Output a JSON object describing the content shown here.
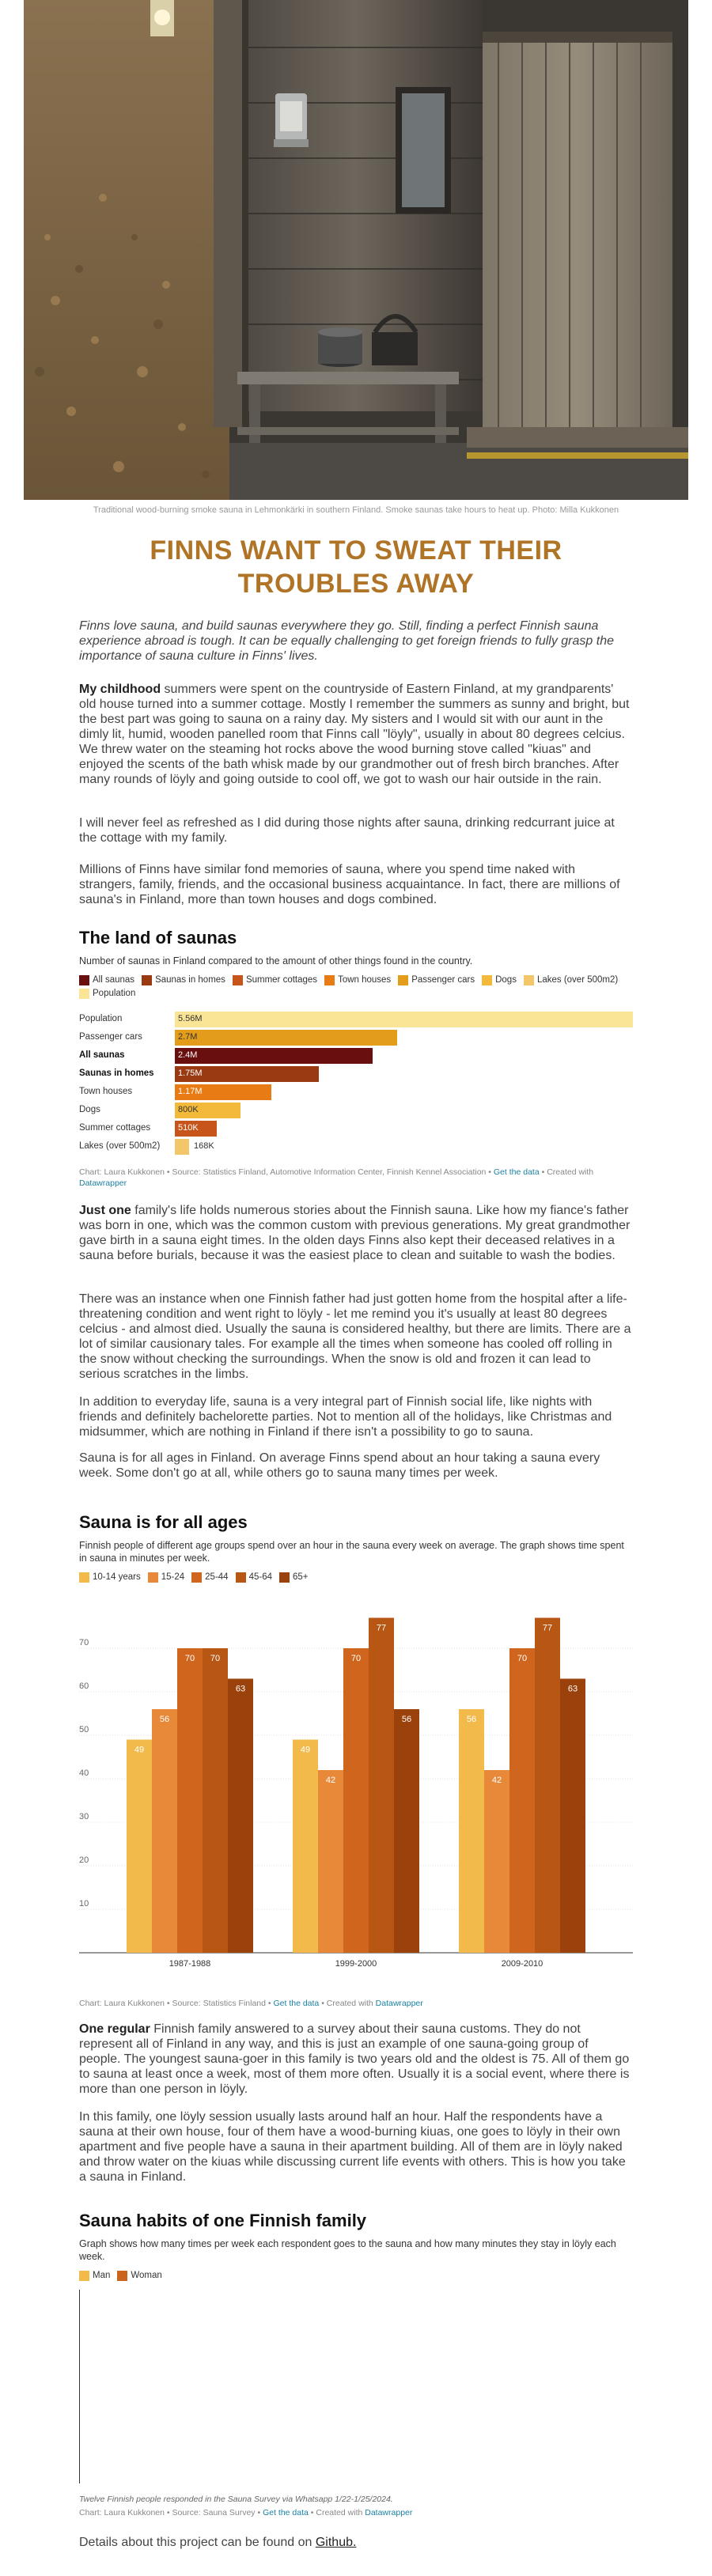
{
  "hero": {
    "caption": "Traditional wood-burning smoke sauna in Lehmonkärki in southern Finland. Smoke saunas take hours to heat up. Photo: Milla Kukkonen"
  },
  "title": "FINNS WANT TO SWEAT THEIR TROUBLES AWAY",
  "intro": "Finns love sauna, and build saunas everywhere they go. Still, finding a perfect Finnish sauna experience abroad is tough. It can be equally challenging to get foreign friends to fully grasp the importance of sauna culture in Finns' lives.",
  "p1_lead": "My childhood",
  "p1": " summers were spent on the countryside of Eastern Finland, at my grandparents' old house turned into a summer cottage. Mostly I remember the summers as sunny and bright, but the best part was going to sauna on a rainy day. My sisters and I would sit with our aunt in the dimly lit, humid, wooden panelled room that Finns call \"löyly\", usually in about 80 degrees celcius. We threw water on the steaming hot rocks above the wood burning stove called \"kiuas\" and enjoyed the scents of the bath whisk made by our grandmother out of fresh birch branches. After many rounds of löyly and going outside to cool off, we got to wash our hair outside in the rain.",
  "p2": "I will never feel as refreshed as I did during those nights after sauna, drinking redcurrant juice at the cottage with my family.",
  "p3": "Millions of Finns have similar fond memories of sauna, where you spend time naked with strangers, family, friends, and the occasional business acquaintance. In fact, there are millions of sauna's in Finland, more than town houses and dogs combined.",
  "chart1": {
    "title": "The land of saunas",
    "subtitle": "Number of saunas in Finland compared to the amount of other things found in the country.",
    "footer": "Chart: Laura Kukkonen • Source: Statistics Finland, Automotive Information Center, Finnish Kennel Association • ",
    "get_data": "Get the data",
    "created": " • Created with ",
    "datawrapper": "Datawrapper"
  },
  "p4_lead": "Just one",
  "p4": " family's life holds numerous stories about the Finnish sauna. Like how my fiance's father was born in one, which was the common custom with previous generations. My great grandmother gave birth in a sauna eight times. In the olden days Finns also kept their deceased relatives in a sauna before burials, because it was the easiest place to clean and suitable to wash the bodies.",
  "p5": "There was an instance when one Finnish father had just gotten home from the hospital after a life-threatening condition and went right to löyly - let me remind you it's usually at least 80 degrees celcius - and almost died. Usually the sauna is considered healthy, but there are limits. There are a lot of similar causionary tales. For example all the times when someone has cooled off rolling in the snow without checking the surroundings. When the snow is old and frozen it can lead to serious scratches in the limbs.",
  "p6": "In addition to everyday life, sauna is a very integral part of Finnish social life, like nights with friends and definitely bachelorette parties. Not to mention all of the holidays, like Christmas and midsummer, which are nothing in Finland if there isn't a possibility to go to sauna.",
  "p7": "Sauna is for all ages in Finland. On average Finns spend about an hour taking a sauna every week. Some don't go at all, while others go to sauna many times per week.",
  "chart2": {
    "title": "Sauna is for all ages",
    "subtitle": "Finnish people of different age groups spend over an hour in the sauna every week on average. The graph shows time spent in sauna in minutes per week.",
    "footer": "Chart: Laura Kukkonen • Source: Statistics Finland • ",
    "get_data": "Get the data",
    "created": " • Created with ",
    "datawrapper": "Datawrapper"
  },
  "p8_lead": "One regular",
  "p8": " Finnish family answered to a survey about their sauna customs. They do not represent all of Finland in any way, and this is just an example of one sauna-going group of people. The youngest sauna-goer in this family is two years old and the oldest is 75. All of them go to sauna at least once a week, most of them more often. Usually it is a social event, where there is more than one person in löyly.",
  "p9": "In this family, one löyly session usually lasts around half an hour. Half the respondents have a sauna at their own house, four of them have a wood-burning kiuas, one goes to löyly in their own apartment and five people have a sauna in their apartment building. All of them are in löyly naked and throw water on the kiuas while discussing current life events with others. This is how you take a sauna in Finland.",
  "chart3": {
    "title": "Sauna habits of one Finnish family",
    "subtitle": "Graph shows how many times per week each respondent goes to the sauna and how many minutes they stay in löyly each week.",
    "note": "Twelve Finnish people responded in the Sauna Survey via Whatsapp 1/22-1/25/2024.",
    "footer": "Chart: Laura Kukkonen • Source: Sauna Survey • ",
    "get_data": "Get the data",
    "created": " • Created with ",
    "datawrapper": "Datawrapper",
    "legend": [
      {
        "name": "Man",
        "color": "#f2b94b"
      },
      {
        "name": "Woman",
        "color": "#c9631d"
      }
    ]
  },
  "outro": "Details about this project can be found on ",
  "outro_link": "Github.",
  "chart_data": [
    {
      "type": "bar",
      "orientation": "horizontal",
      "title": "The land of saunas",
      "categories": [
        "Population",
        "Passenger cars",
        "All saunas",
        "Saunas in homes",
        "Town houses",
        "Dogs",
        "Summer cottages",
        "Lakes (over 500m2)"
      ],
      "values": [
        5.56,
        2.7,
        2.4,
        1.75,
        1.17,
        0.8,
        0.51,
        0.168
      ],
      "value_labels": [
        "5.56M",
        "2.7M",
        "2.4M",
        "1.75M",
        "1.17M",
        "800K",
        "510K",
        "168K"
      ],
      "colors": [
        "#fae596",
        "#e39d1a",
        "#6a0f10",
        "#9a3a12",
        "#e87b13",
        "#f2b93b",
        "#c7541a",
        "#f4c66a"
      ],
      "legend": [
        {
          "name": "All saunas",
          "color": "#6a0f10"
        },
        {
          "name": "Saunas in homes",
          "color": "#9a3a12"
        },
        {
          "name": "Summer cottages",
          "color": "#c7541a"
        },
        {
          "name": "Town houses",
          "color": "#e87b13"
        },
        {
          "name": "Passenger cars",
          "color": "#e39d1a"
        },
        {
          "name": "Dogs",
          "color": "#f2b93b"
        },
        {
          "name": "Lakes (over 500m2)",
          "color": "#f4c66a"
        },
        {
          "name": "Population",
          "color": "#fae596"
        }
      ],
      "bold_labels": [
        "All saunas",
        "Saunas in homes"
      ],
      "xlim": [
        0,
        5.56
      ]
    },
    {
      "type": "bar",
      "title": "Sauna is for all ages",
      "categories": [
        "1987-1988",
        "1999-2000",
        "2009-2010"
      ],
      "series": [
        {
          "name": "10-14 years",
          "color": "#f2b94b",
          "values": [
            49,
            49,
            56
          ]
        },
        {
          "name": "15-24",
          "color": "#e8893a",
          "values": [
            56,
            42,
            42
          ]
        },
        {
          "name": "25-44",
          "color": "#d0661e",
          "values": [
            70,
            70,
            70
          ]
        },
        {
          "name": "45-64",
          "color": "#b85613",
          "values": [
            70,
            77,
            77
          ]
        },
        {
          "name": "65+",
          "color": "#9b420c",
          "values": [
            63,
            56,
            63
          ]
        }
      ],
      "yticks": [
        10,
        20,
        30,
        40,
        50,
        60,
        70
      ],
      "ylim": [
        0,
        80
      ],
      "grid": true
    }
  ]
}
